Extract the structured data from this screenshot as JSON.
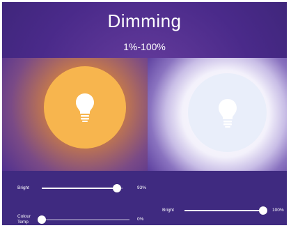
{
  "header": {
    "title": "Dimming",
    "subtitle": "1%-100%"
  },
  "colors": {
    "background": "#4a2a8a",
    "warm_bulb": "#f7b54e",
    "cool_bulb": "#e9eefa",
    "controls_bg": "#3f2a80"
  },
  "left_controls": {
    "bright": {
      "label": "Bright",
      "value_text": "93%",
      "value": 93
    },
    "colour_temp": {
      "label": "Colour Temp",
      "value_text": "0%",
      "value": 0
    }
  },
  "right_controls": {
    "bright": {
      "label": "Bright",
      "value_text": "100%",
      "value": 100
    }
  }
}
